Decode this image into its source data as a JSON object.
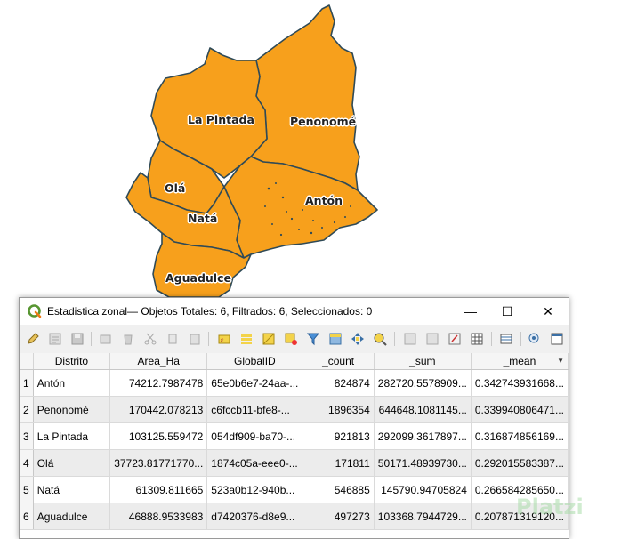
{
  "map": {
    "fill_color": "#f7a01c",
    "labels": [
      {
        "key": "la_pintada",
        "text": "La Pintada"
      },
      {
        "key": "penonome",
        "text": "Penonomé"
      },
      {
        "key": "ola",
        "text": "Olá"
      },
      {
        "key": "nata",
        "text": "Natá"
      },
      {
        "key": "anton",
        "text": "Antón"
      },
      {
        "key": "aguadulce",
        "text": "Aguadulce"
      }
    ]
  },
  "window": {
    "title": "Estadistica zonal— Objetos Totales: 6, Filtrados: 6, Seleccionados: 0",
    "minimize": "—",
    "maximize": "☐",
    "close": "✕"
  },
  "toolbar": {
    "icons": [
      "pencil-icon",
      "multi-edit-icon",
      "save-icon",
      "add-feature-icon",
      "delete-icon",
      "cut-icon",
      "copy-icon",
      "paste-icon",
      "select-expression-icon",
      "select-all-icon",
      "invert-selection-icon",
      "deselect-icon",
      "filter-icon",
      "move-selection-top-icon",
      "pan-to-selection-icon",
      "zoom-to-selection-icon",
      "new-field-icon",
      "delete-field-icon",
      "field-calculator-icon",
      "conditional-format-icon",
      "dock-icon",
      "actions-icon",
      "form-view-icon"
    ]
  },
  "table": {
    "columns": [
      "Distrito",
      "Area_Ha",
      "GlobalID",
      "_count",
      "_sum",
      "_mean"
    ],
    "rows": [
      {
        "n": "1",
        "distrito": "Antón",
        "area": "74212.7987478",
        "gid": "65e0b6e7-24aa-...",
        "count": "824874",
        "sum": "282720.5578909...",
        "mean": "0.342743931668..."
      },
      {
        "n": "2",
        "distrito": "Penonomé",
        "area": "170442.078213",
        "gid": "c6fccb11-bfe8-...",
        "count": "1896354",
        "sum": "644648.1081145...",
        "mean": "0.339940806471..."
      },
      {
        "n": "3",
        "distrito": "La Pintada",
        "area": "103125.559472",
        "gid": "054df909-ba70-...",
        "count": "921813",
        "sum": "292099.3617897...",
        "mean": "0.316874856169..."
      },
      {
        "n": "4",
        "distrito": "Olá",
        "area": "37723.81771770...",
        "gid": "1874c05a-eee0-...",
        "count": "171811",
        "sum": "50171.48939730...",
        "mean": "0.292015583387..."
      },
      {
        "n": "5",
        "distrito": "Natá",
        "area": "61309.811665",
        "gid": "523a0b12-940b...",
        "count": "546885",
        "sum": "145790.94705824",
        "mean": "0.266584285650..."
      },
      {
        "n": "6",
        "distrito": "Aguadulce",
        "area": "46888.9533983",
        "gid": "d7420376-d8e9...",
        "count": "497273",
        "sum": "103368.7944729...",
        "mean": "0.207871319120..."
      }
    ]
  },
  "watermark": "Platzi"
}
